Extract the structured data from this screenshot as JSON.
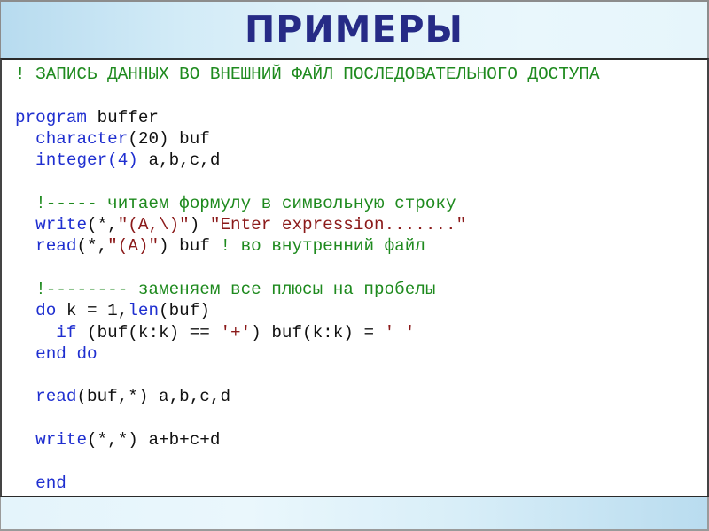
{
  "slide": {
    "title": "ПРИМЕРЫ",
    "colors": {
      "title": "#262b86",
      "keyword": "#1f2fd0",
      "comment": "#1e8a1e",
      "string": "#8b1a1a",
      "plain": "#111111"
    },
    "code_lines": [
      [
        {
          "t": "cm",
          "v": "! ЗАПИСЬ ДАННЫХ ВО ВНЕШНИЙ ФАЙЛ ПОСЛЕДОВАТЕЛЬНОГО ДОСТУПА"
        }
      ],
      [],
      [
        {
          "t": "kw",
          "v": "program"
        },
        {
          "t": "pl",
          "v": " buffer"
        }
      ],
      [
        {
          "t": "pl",
          "v": "  "
        },
        {
          "t": "kw",
          "v": "character"
        },
        {
          "t": "pl",
          "v": "(20) buf"
        }
      ],
      [
        {
          "t": "pl",
          "v": "  "
        },
        {
          "t": "kw",
          "v": "integer(4)"
        },
        {
          "t": "pl",
          "v": " a,b,c,d"
        }
      ],
      [],
      [
        {
          "t": "pl",
          "v": "  "
        },
        {
          "t": "cm",
          "v": "!----- читаем формулу в символьную строку"
        }
      ],
      [
        {
          "t": "pl",
          "v": "  "
        },
        {
          "t": "kw",
          "v": "write"
        },
        {
          "t": "pl",
          "v": "(*,"
        },
        {
          "t": "st",
          "v": "\"(A,\\)\""
        },
        {
          "t": "pl",
          "v": ") "
        },
        {
          "t": "st",
          "v": "\"Enter expression.......\""
        }
      ],
      [
        {
          "t": "pl",
          "v": "  "
        },
        {
          "t": "kw",
          "v": "read"
        },
        {
          "t": "pl",
          "v": "(*,"
        },
        {
          "t": "st",
          "v": "\"(A)\""
        },
        {
          "t": "pl",
          "v": ") buf "
        },
        {
          "t": "cm",
          "v": "! во внутренний файл"
        }
      ],
      [],
      [
        {
          "t": "pl",
          "v": "  "
        },
        {
          "t": "cm",
          "v": "!-------- заменяем все плюсы на пробелы"
        }
      ],
      [
        {
          "t": "pl",
          "v": "  "
        },
        {
          "t": "kw",
          "v": "do"
        },
        {
          "t": "pl",
          "v": " k = 1,"
        },
        {
          "t": "kw",
          "v": "len"
        },
        {
          "t": "pl",
          "v": "(buf)"
        }
      ],
      [
        {
          "t": "pl",
          "v": "    "
        },
        {
          "t": "kw",
          "v": "if"
        },
        {
          "t": "pl",
          "v": " (buf(k:k) == "
        },
        {
          "t": "st",
          "v": "'+'"
        },
        {
          "t": "pl",
          "v": ") buf(k:k) = "
        },
        {
          "t": "st",
          "v": "' '"
        }
      ],
      [
        {
          "t": "pl",
          "v": "  "
        },
        {
          "t": "kw",
          "v": "end do"
        }
      ],
      [],
      [
        {
          "t": "pl",
          "v": "  "
        },
        {
          "t": "kw",
          "v": "read"
        },
        {
          "t": "pl",
          "v": "(buf,*) a,b,c,d"
        }
      ],
      [],
      [
        {
          "t": "pl",
          "v": "  "
        },
        {
          "t": "kw",
          "v": "write"
        },
        {
          "t": "pl",
          "v": "(*,*) a+b+c+d"
        }
      ],
      [],
      [
        {
          "t": "pl",
          "v": "  "
        },
        {
          "t": "kw",
          "v": "end"
        }
      ]
    ]
  }
}
